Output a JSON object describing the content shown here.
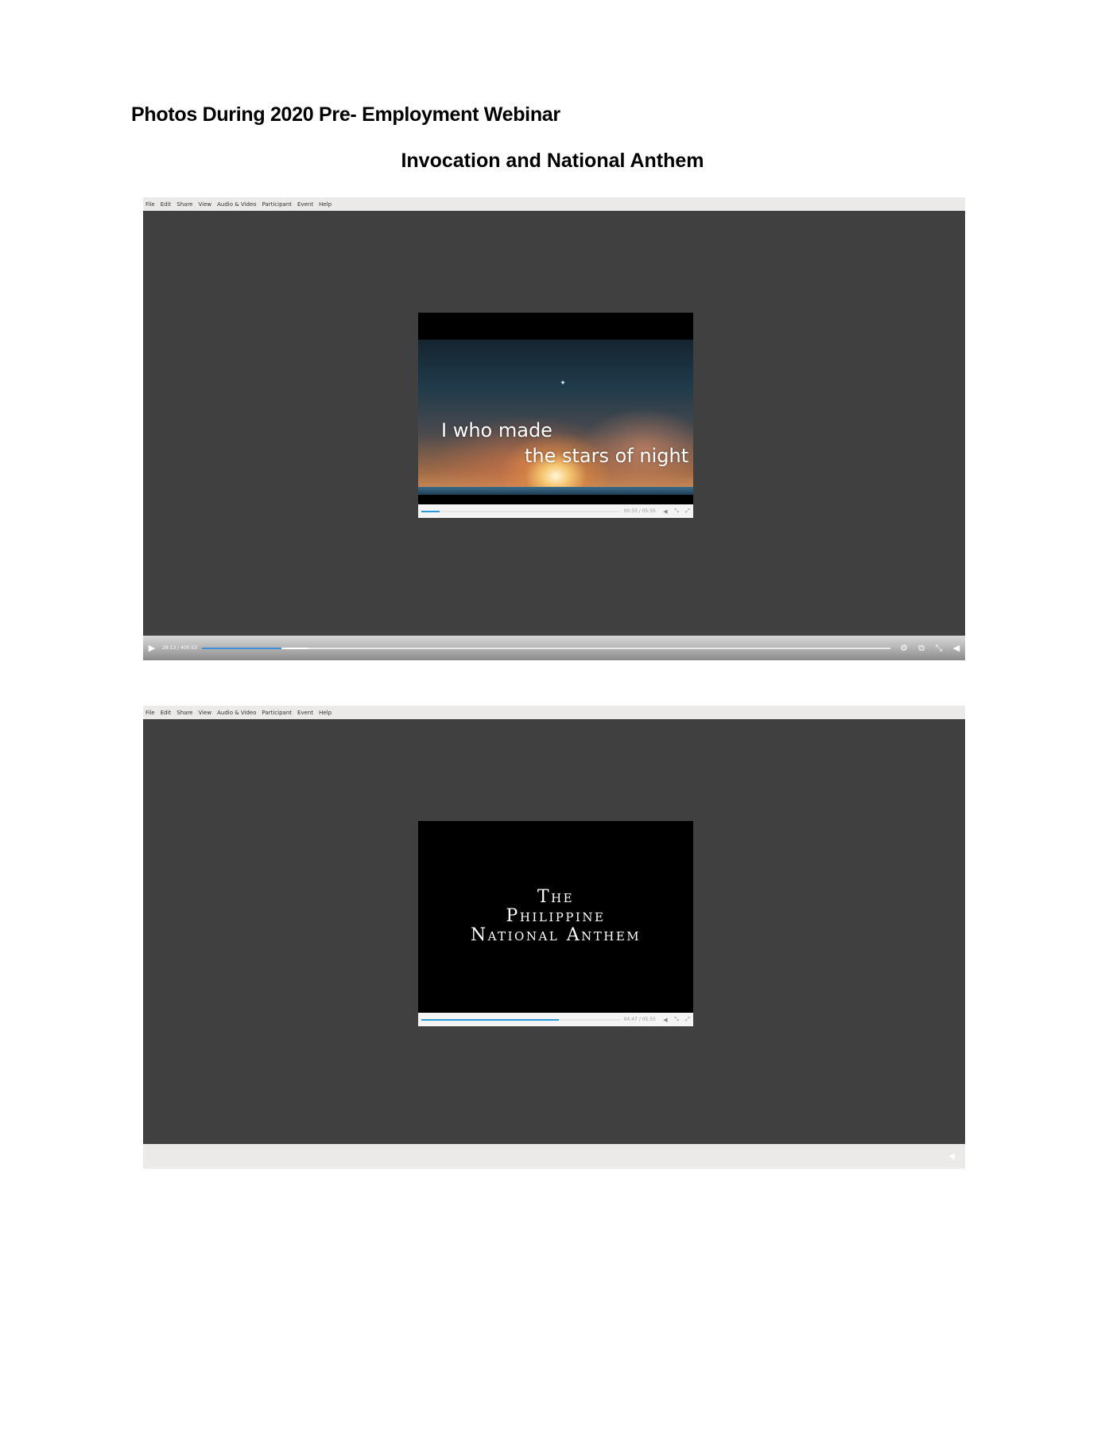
{
  "document": {
    "title": "Photos During 2020 Pre- Employment Webinar",
    "subtitle": "Invocation and National Anthem"
  },
  "menu": [
    "File",
    "Edit",
    "Share",
    "View",
    "Audio & Video",
    "Participant",
    "Event",
    "Help"
  ],
  "screenshots": [
    {
      "video": {
        "lyric_line1": "I who made",
        "lyric_line2": "the stars of night",
        "time": "00:33 / 05:55",
        "progress": 0.09
      },
      "player": {
        "time": "28:13 / 405:53",
        "progress": 0.115,
        "buffered_to": 0.155
      }
    },
    {
      "video": {
        "title_line1": "The",
        "title_line2": "Philippine",
        "title_line3": "National Anthem",
        "time": "04:47 / 05:55",
        "progress": 0.69
      }
    }
  ],
  "icons": {
    "play": "play-icon",
    "volume": "volume-icon",
    "settings": "gear-icon",
    "pip": "picture-in-picture-icon",
    "exit_fullscreen": "exit-fullscreen-icon",
    "expand": "expand-icon"
  },
  "colors": {
    "viewer_background": "#404040",
    "progress_accent": "#2a9bd6"
  }
}
